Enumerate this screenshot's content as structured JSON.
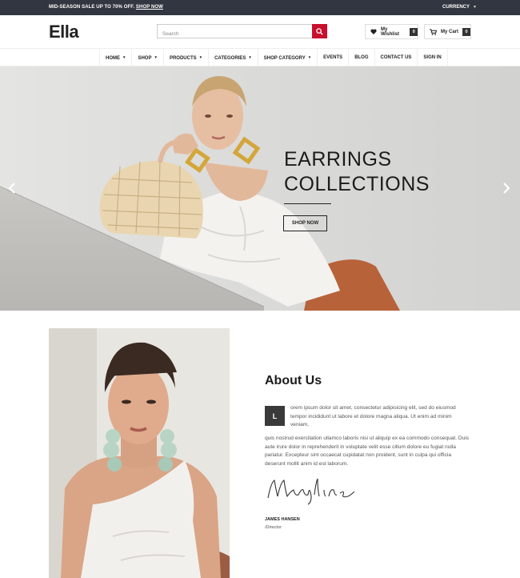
{
  "topbar": {
    "promo_text": "MID-SEASON SALE UP TO 70% OFF.",
    "promo_link": "SHOP NOW",
    "currency_label": "CURRENCY"
  },
  "header": {
    "logo_text": "Ell",
    "logo_last": "a",
    "search_placeholder": "Search",
    "wishlist_label": "My Wishlist",
    "wishlist_count": "0",
    "cart_label": "My Cart",
    "cart_count": "0"
  },
  "nav": {
    "items": [
      {
        "label": "HOME",
        "dropdown": true
      },
      {
        "label": "SHOP",
        "dropdown": true
      },
      {
        "label": "PRODUCTS",
        "dropdown": true
      },
      {
        "label": "CATEGORIES",
        "dropdown": true
      },
      {
        "label": "SHOP CATEGORY",
        "dropdown": true
      },
      {
        "label": "EVENTS",
        "dropdown": false
      },
      {
        "label": "BLOG",
        "dropdown": false
      },
      {
        "label": "CONTACT US",
        "dropdown": false
      },
      {
        "label": "SIGN IN",
        "dropdown": false
      }
    ]
  },
  "hero": {
    "title_line1": "EARRINGS",
    "title_line2": "COLLECTIONS",
    "button_label": "SHOP NOW",
    "prev_icon": "chevron-left-icon",
    "next_icon": "chevron-right-icon"
  },
  "about": {
    "title": "About Us",
    "dropcap": "L",
    "paragraph1": "orem ipsum dolor sit amet, consectetur adipisicing elit, sed do eiusmod tempor incididunt ut labore et dolore magna aliqua. Ut enim ad minim veniam,",
    "paragraph2": "quis nostrud exercitation ullamco laboris nisi ut aliquip ex ea commodo consequat. Duis aute irure dolor in reprehenderit in voluptate velit esse cillum dolore eu fugiat nulla pariatur. Excepteur sint occaecat cupidatat non proident, sunt in culpa qui officia deserunt mollit anim id est laborum.",
    "signature": "Mayline",
    "name": "JAMES HANSEN",
    "role": "/Director"
  },
  "colors": {
    "topbar_bg": "#323640",
    "accent_red": "#c8102e",
    "text_dark": "#222222"
  }
}
